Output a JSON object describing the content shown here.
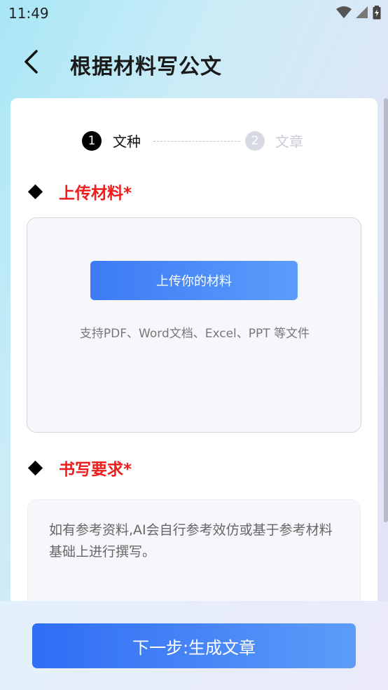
{
  "status": {
    "time": "11:49"
  },
  "header": {
    "title": "根据材料写公文"
  },
  "steps": [
    {
      "number": "1",
      "label": "文种"
    },
    {
      "number": "2",
      "label": "文章"
    }
  ],
  "upload_section": {
    "title": "上传材料*",
    "button_label": "上传你的材料",
    "hint": "支持PDF、Word文档、Excel、PPT 等文件"
  },
  "requirements_section": {
    "title": "书写要求*",
    "placeholder": "如有参考资料,AI会自行参考效仿或基于参考材料基础上进行撰写。"
  },
  "footer": {
    "next_label": "下一步:生成文章"
  },
  "colors": {
    "accent": "#3c7bf5",
    "required_title": "#ee1c1c"
  },
  "icons": [
    "wifi-icon",
    "signal-icon",
    "battery-icon",
    "back-arrow-icon",
    "diamond-bullet-icon"
  ]
}
